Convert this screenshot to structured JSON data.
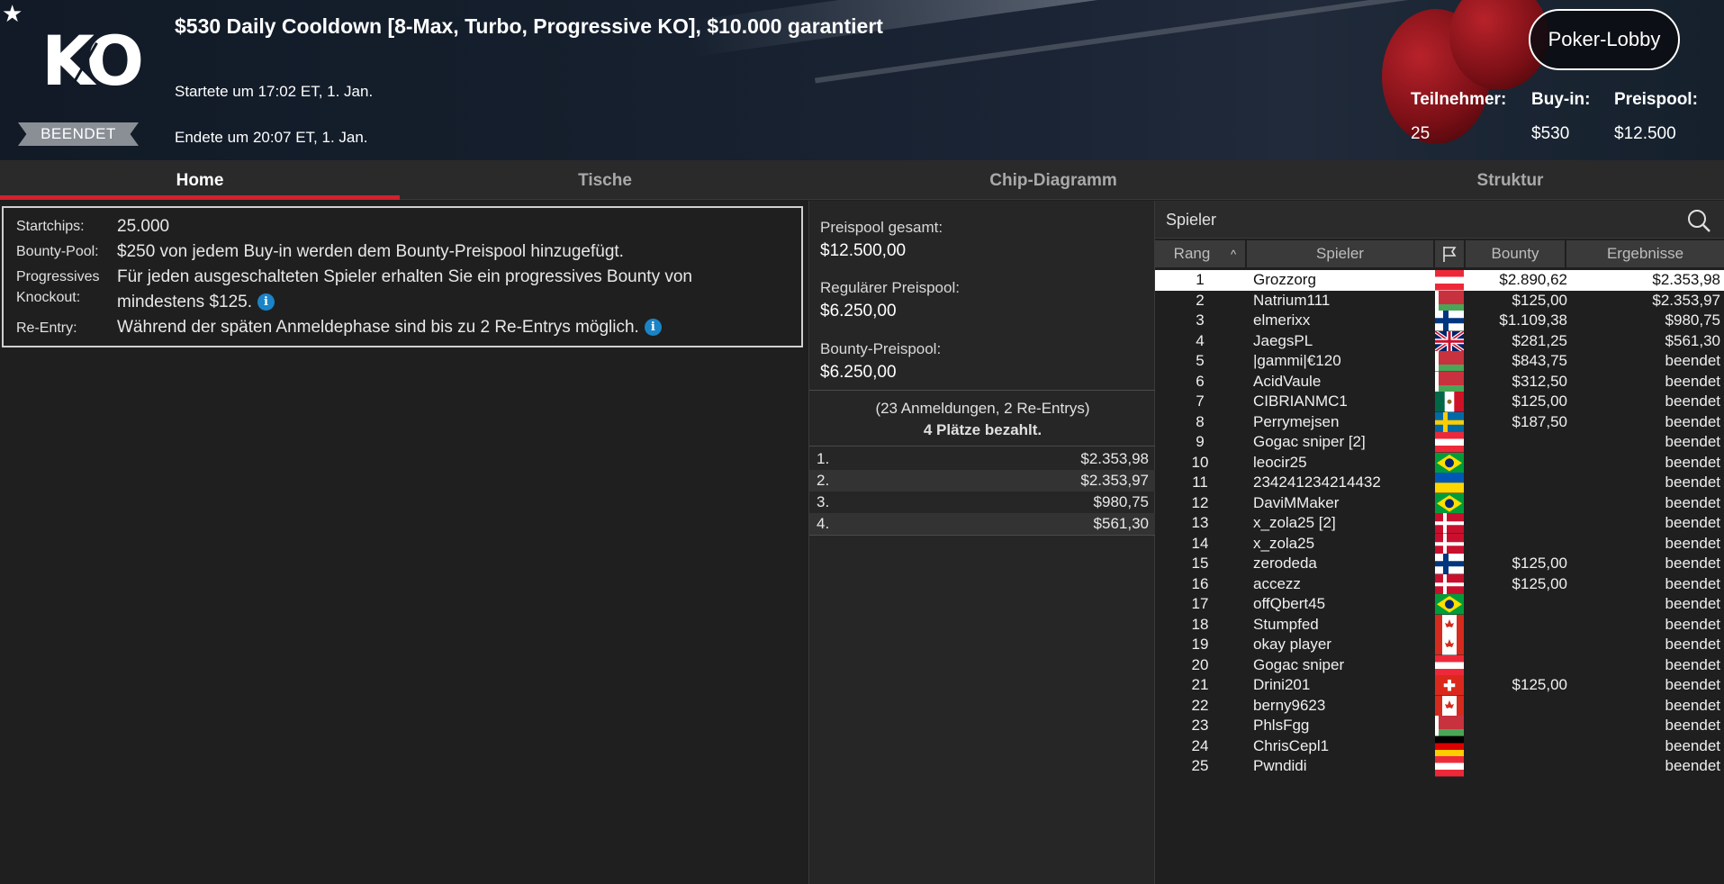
{
  "header": {
    "title": "$530 Daily Cooldown [8-Max, Turbo, Progressive KO], $10.000 garantiert",
    "start": "Startete um 17:02 ET, 1. Jan.",
    "end": "Endete um 20:07 ET, 1. Jan.",
    "status": "BEENDET",
    "lobby_button": "Poker-Lobby",
    "stats": {
      "participants_label": "Teilnehmer:",
      "participants": "25",
      "buyin_label": "Buy-in:",
      "buyin": "$530",
      "prizepool_label": "Preispool:",
      "prizepool": "$12.500"
    }
  },
  "tabs": [
    "Home",
    "Tische",
    "Chip-Diagramm",
    "Struktur"
  ],
  "active_tab": "Home",
  "info": {
    "startchips_label": "Startchips:",
    "startchips": "25.000",
    "bounty_label": "Bounty-Pool:",
    "bounty": "$250 von jedem Buy-in werden dem Bounty-Preispool hinzugefügt.",
    "ko_label1": "Progressives",
    "ko_label2": "Knockout:",
    "ko_line1": "Für jeden ausgeschalteten Spieler erhalten Sie ein progressives Bounty von",
    "ko_line2": "mindestens $125.",
    "reentry_label": "Re-Entry:",
    "reentry": "Während der späten Anmeldephase sind bis zu 2 Re-Entrys möglich."
  },
  "prize": {
    "total_label": "Preispool gesamt:",
    "total": "$12.500,00",
    "regular_label": "Regulärer Preispool:",
    "regular": "$6.250,00",
    "bounty_label": "Bounty-Preispool:",
    "bounty": "$6.250,00",
    "entries_note": "(23 Anmeldungen, 2 Re-Entrys)",
    "paid_note": "4 Plätze bezahlt.",
    "payouts": [
      {
        "place": "1.",
        "amount": "$2.353,98"
      },
      {
        "place": "2.",
        "amount": "$2.353,97"
      },
      {
        "place": "3.",
        "amount": "$980,75"
      },
      {
        "place": "4.",
        "amount": "$561,30"
      }
    ]
  },
  "players": {
    "search_label": "Spieler",
    "columns": {
      "rank": "Rang",
      "player": "Spieler",
      "bounty": "Bounty",
      "result": "Ergebnisse"
    },
    "rows": [
      {
        "rank": "1",
        "name": "Grozzorg",
        "flag": "austria",
        "bounty": "$2.890,62",
        "result": "$2.353,98"
      },
      {
        "rank": "2",
        "name": "Natrium111",
        "flag": "belarus",
        "bounty": "$125,00",
        "result": "$2.353,97"
      },
      {
        "rank": "3",
        "name": "elmerixx",
        "flag": "finland",
        "bounty": "$1.109,38",
        "result": "$980,75"
      },
      {
        "rank": "4",
        "name": "JaegsPL",
        "flag": "uk",
        "bounty": "$281,25",
        "result": "$561,30"
      },
      {
        "rank": "5",
        "name": "|gammi|€120",
        "flag": "belarus",
        "bounty": "$843,75",
        "result": "beendet"
      },
      {
        "rank": "6",
        "name": "AcidVaule",
        "flag": "belarus",
        "bounty": "$312,50",
        "result": "beendet"
      },
      {
        "rank": "7",
        "name": "CIBRIANMC1",
        "flag": "mexico",
        "bounty": "$125,00",
        "result": "beendet"
      },
      {
        "rank": "8",
        "name": "Perrymejsen",
        "flag": "sweden",
        "bounty": "$187,50",
        "result": "beendet"
      },
      {
        "rank": "9",
        "name": "Gogac sniper [2]",
        "flag": "austria",
        "bounty": "",
        "result": "beendet"
      },
      {
        "rank": "10",
        "name": "leocir25",
        "flag": "brazil",
        "bounty": "",
        "result": "beendet"
      },
      {
        "rank": "11",
        "name": "234241234214432",
        "flag": "ukraine",
        "bounty": "",
        "result": "beendet"
      },
      {
        "rank": "12",
        "name": "DaviMMaker",
        "flag": "brazil",
        "bounty": "",
        "result": "beendet"
      },
      {
        "rank": "13",
        "name": "x_zola25 [2]",
        "flag": "denmark",
        "bounty": "",
        "result": "beendet"
      },
      {
        "rank": "14",
        "name": "x_zola25",
        "flag": "denmark",
        "bounty": "",
        "result": "beendet"
      },
      {
        "rank": "15",
        "name": "zerodeda",
        "flag": "finland",
        "bounty": "$125,00",
        "result": "beendet"
      },
      {
        "rank": "16",
        "name": "accezz",
        "flag": "denmark",
        "bounty": "$125,00",
        "result": "beendet"
      },
      {
        "rank": "17",
        "name": "offQbert45",
        "flag": "brazil",
        "bounty": "",
        "result": "beendet"
      },
      {
        "rank": "18",
        "name": "Stumpfed",
        "flag": "canada",
        "bounty": "",
        "result": "beendet"
      },
      {
        "rank": "19",
        "name": "okay player",
        "flag": "canada",
        "bounty": "",
        "result": "beendet"
      },
      {
        "rank": "20",
        "name": "Gogac sniper",
        "flag": "austria",
        "bounty": "",
        "result": "beendet"
      },
      {
        "rank": "21",
        "name": "Drini201",
        "flag": "switzerland",
        "bounty": "$125,00",
        "result": "beendet"
      },
      {
        "rank": "22",
        "name": "berny9623",
        "flag": "canada",
        "bounty": "",
        "result": "beendet"
      },
      {
        "rank": "23",
        "name": "PhlsFgg",
        "flag": "belarus",
        "bounty": "",
        "result": "beendet"
      },
      {
        "rank": "24",
        "name": "ChrisCepl1",
        "flag": "germany",
        "bounty": "",
        "result": "beendet"
      },
      {
        "rank": "25",
        "name": "Pwndidi",
        "flag": "austria",
        "bounty": "",
        "result": "beendet"
      }
    ]
  },
  "colors": {
    "accent": "#d2202f",
    "info_icon": "#1a84c7"
  }
}
